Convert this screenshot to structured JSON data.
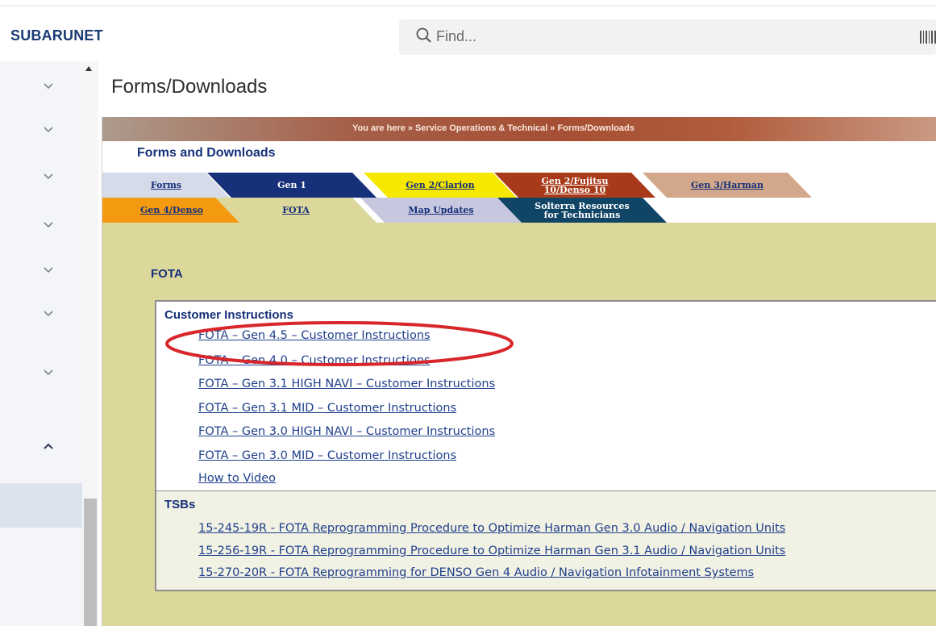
{
  "header": {
    "brand": "SUBARUNET",
    "search_placeholder": "Find...",
    "icons": {
      "search": "search-icon",
      "barcode": "barcode-icon"
    }
  },
  "sidebar": {
    "items": [
      "chevron-down-icon",
      "chevron-down-icon",
      "chevron-down-icon",
      "chevron-down-icon",
      "chevron-down-icon",
      "chevron-down-icon",
      "chevron-down-icon",
      "chevron-up-icon"
    ]
  },
  "page": {
    "title": "Forms/Downloads",
    "breadcrumb": "You are here » Service Operations & Technical » Forms/Downloads",
    "header_tab": "Forms and Downloads",
    "tabs_row1": {
      "forms": "Forms",
      "gen1": "Gen 1",
      "gen2_clarion": "Gen 2/Clarion",
      "gen2_fujitsu_line1": "Gen 2/Fujitsu",
      "gen2_fujitsu_line2": "10/Denso 10",
      "gen3_harman": "Gen 3/Harman"
    },
    "tabs_row2": {
      "gen4_denso": "Gen 4/Denso",
      "fota": "FOTA",
      "map_updates": "Map Updates",
      "solterra_line1": "Solterra Resources",
      "solterra_line2": "for Technicians"
    },
    "section_heading": "FOTA",
    "customer_instructions": {
      "title": "Customer Instructions",
      "links": [
        "FOTA – Gen 4.5 – Customer Instructions",
        "FOTA – Gen 4.0 – Customer Instructions",
        "FOTA – Gen 3.1 HIGH NAVI – Customer Instructions",
        "FOTA – Gen 3.1 MID – Customer Instructions",
        "FOTA – Gen 3.0 HIGH NAVI – Customer Instructions",
        "FOTA – Gen 3.0 MID – Customer Instructions",
        "How to Video"
      ]
    },
    "tsbs": {
      "title": "TSBs",
      "links": [
        "15-245-19R - FOTA Reprogramming Procedure to Optimize Harman Gen 3.0 Audio / Navigation Units",
        "15-256-19R - FOTA Reprogramming Procedure to Optimize Harman Gen 3.1 Audio / Navigation Units",
        "15-270-20R - FOTA Reprogramming for DENSO Gen 4 Audio / Navigation Infotainment Systems"
      ]
    },
    "annotation_color": "#d8262b"
  }
}
